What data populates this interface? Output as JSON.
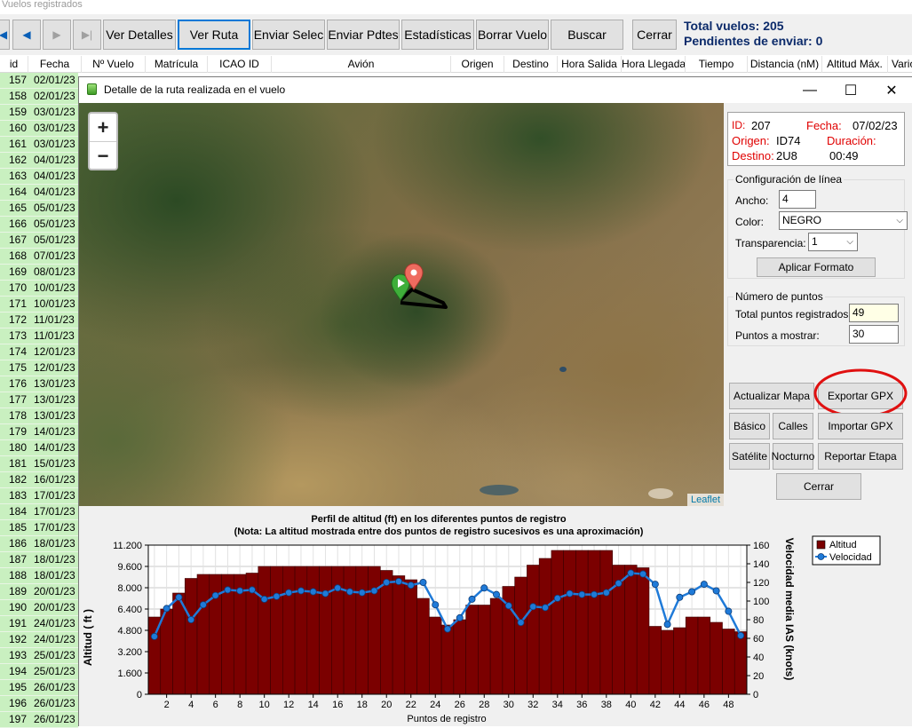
{
  "main_window": {
    "title": "Vuelos registrados",
    "toolbar": {
      "nav_first": "◀",
      "nav_prev": "◀",
      "nav_next": "▶",
      "nav_last": "▶|",
      "buttons": [
        "Ver Detalles",
        "Ver Ruta",
        "Enviar Selec",
        "Enviar Pdtes",
        "Estadísticas",
        "Borrar Vuelo",
        "Buscar",
        "Cerrar"
      ]
    },
    "totals": {
      "total_vuelos": "Total vuelos: 205",
      "pendientes": "Pendientes de enviar: 0"
    },
    "grid": {
      "columns": [
        "id",
        "Fecha",
        "Nº Vuelo",
        "Matrícula",
        "ICAO ID",
        "Avión",
        "Origen",
        "Destino",
        "Hora Salida",
        "Hora Llegada",
        "Tiempo",
        "Distancia (nM)",
        "Altitud Máx.",
        "Vario"
      ],
      "rows": [
        [
          "157",
          "02/01/23"
        ],
        [
          "158",
          "02/01/23"
        ],
        [
          "159",
          "03/01/23"
        ],
        [
          "160",
          "03/01/23"
        ],
        [
          "161",
          "03/01/23"
        ],
        [
          "162",
          "04/01/23"
        ],
        [
          "163",
          "04/01/23"
        ],
        [
          "164",
          "04/01/23"
        ],
        [
          "165",
          "05/01/23"
        ],
        [
          "166",
          "05/01/23"
        ],
        [
          "167",
          "05/01/23"
        ],
        [
          "168",
          "07/01/23"
        ],
        [
          "169",
          "08/01/23"
        ],
        [
          "170",
          "10/01/23"
        ],
        [
          "171",
          "10/01/23"
        ],
        [
          "172",
          "11/01/23"
        ],
        [
          "173",
          "11/01/23"
        ],
        [
          "174",
          "12/01/23"
        ],
        [
          "175",
          "12/01/23"
        ],
        [
          "176",
          "13/01/23"
        ],
        [
          "177",
          "13/01/23"
        ],
        [
          "178",
          "13/01/23"
        ],
        [
          "179",
          "14/01/23"
        ],
        [
          "180",
          "14/01/23"
        ],
        [
          "181",
          "15/01/23"
        ],
        [
          "182",
          "16/01/23"
        ],
        [
          "183",
          "17/01/23"
        ],
        [
          "184",
          "17/01/23"
        ],
        [
          "185",
          "17/01/23"
        ],
        [
          "186",
          "18/01/23"
        ],
        [
          "187",
          "18/01/23"
        ],
        [
          "188",
          "18/01/23"
        ],
        [
          "189",
          "20/01/23"
        ],
        [
          "190",
          "20/01/23"
        ],
        [
          "191",
          "24/01/23"
        ],
        [
          "192",
          "24/01/23"
        ],
        [
          "193",
          "25/01/23"
        ],
        [
          "194",
          "25/01/23"
        ],
        [
          "195",
          "26/01/23"
        ],
        [
          "196",
          "26/01/23"
        ],
        [
          "197",
          "26/01/23"
        ]
      ]
    }
  },
  "dialog": {
    "title": "Detalle de la ruta realizada en el vuelo",
    "window_buttons": {
      "minimize": "—",
      "maximize": "☐",
      "close": "✕"
    },
    "map": {
      "zoom_in": "+",
      "zoom_out": "−",
      "attribution": "Leaflet"
    },
    "info": {
      "id_label": "ID:",
      "id_value": "207",
      "fecha_label": "Fecha:",
      "fecha_value": "07/02/23",
      "origen_label": "Origen:",
      "origen_value": "ID74",
      "duracion_label": "Duración:",
      "destino_label": "Destino:",
      "destino_value": "2U8",
      "duracion_value": "00:49"
    },
    "line_config": {
      "group_title": "Configuración de línea",
      "ancho_label": "Ancho:",
      "ancho_value": "4",
      "color_label": "Color:",
      "color_value": "NEGRO",
      "transparencia_label": "Transparencia:",
      "transparencia_value": "1",
      "apply_button": "Aplicar Formato"
    },
    "points": {
      "group_title": "Número de puntos",
      "total_label": "Total puntos registrados:",
      "total_value": "49",
      "mostrar_label": "Puntos a mostrar:",
      "mostrar_value": "30"
    },
    "buttons": {
      "actualizar": "Actualizar Mapa",
      "exportar": "Exportar GPX",
      "basico": "Básico",
      "calles": "Calles",
      "importar": "Importar GPX",
      "satelite": "Satélite",
      "nocturno": "Nocturno",
      "reportar": "Reportar Etapa",
      "cerrar": "Cerrar"
    }
  },
  "chart_data": {
    "type": "bar",
    "title": "Perfil de altitud (ft) en los diferentes puntos de registro",
    "subtitle": "(Nota: La altitud mostrada entre dos puntos de registro sucesivos es una aproximación)",
    "xlabel": "Puntos de registro",
    "ylabel": "Altitud ( ft )",
    "y2label": "Velocidad media IAS (knots)",
    "x": [
      1,
      2,
      3,
      4,
      5,
      6,
      7,
      8,
      9,
      10,
      11,
      12,
      13,
      14,
      15,
      16,
      17,
      18,
      19,
      20,
      21,
      22,
      23,
      24,
      25,
      26,
      27,
      28,
      29,
      30,
      31,
      32,
      33,
      34,
      35,
      36,
      37,
      38,
      39,
      40,
      41,
      42,
      43,
      44,
      45,
      46,
      47,
      48,
      49
    ],
    "x_tick_labels": [
      "2",
      "4",
      "6",
      "8",
      "10",
      "12",
      "14",
      "16",
      "18",
      "20",
      "22",
      "24",
      "26",
      "28",
      "30",
      "32",
      "34",
      "36",
      "38",
      "40",
      "42",
      "44",
      "46",
      "48"
    ],
    "xlim": [
      0.5,
      49.5
    ],
    "ylim": [
      0,
      11200
    ],
    "y_ticks": [
      "0",
      "1.600",
      "3.200",
      "4.800",
      "6.400",
      "8.000",
      "9.600",
      "11.200"
    ],
    "y2lim": [
      0,
      160
    ],
    "y2_ticks": [
      "0",
      "20",
      "40",
      "60",
      "80",
      "100",
      "120",
      "140",
      "160"
    ],
    "legend_position": "top-right",
    "grid": true,
    "series": [
      {
        "name": "Altitud",
        "kind": "bar",
        "color": "#7b0000",
        "values": [
          5800,
          6400,
          7600,
          8700,
          9000,
          9000,
          9000,
          9000,
          9100,
          9600,
          9600,
          9600,
          9600,
          9600,
          9600,
          9600,
          9600,
          9600,
          9600,
          9300,
          8900,
          8600,
          7200,
          5800,
          5200,
          5600,
          6700,
          6700,
          7200,
          8100,
          8800,
          9700,
          10200,
          10800,
          10800,
          10800,
          10800,
          10800,
          9700,
          9700,
          9500,
          5100,
          4800,
          5000,
          5800,
          5800,
          5400,
          4900,
          4700
        ]
      },
      {
        "name": "Velocidad",
        "kind": "line",
        "color": "#1f7ad8",
        "values": [
          62,
          92,
          104,
          80,
          96,
          106,
          112,
          111,
          112,
          102,
          105,
          109,
          111,
          110,
          108,
          114,
          110,
          109,
          111,
          120,
          121,
          117,
          120,
          96,
          70,
          82,
          102,
          114,
          107,
          95,
          77,
          94,
          93,
          103,
          108,
          107,
          107,
          109,
          119,
          130,
          129,
          118,
          75,
          104,
          110,
          118,
          111,
          89,
          63
        ]
      }
    ]
  }
}
